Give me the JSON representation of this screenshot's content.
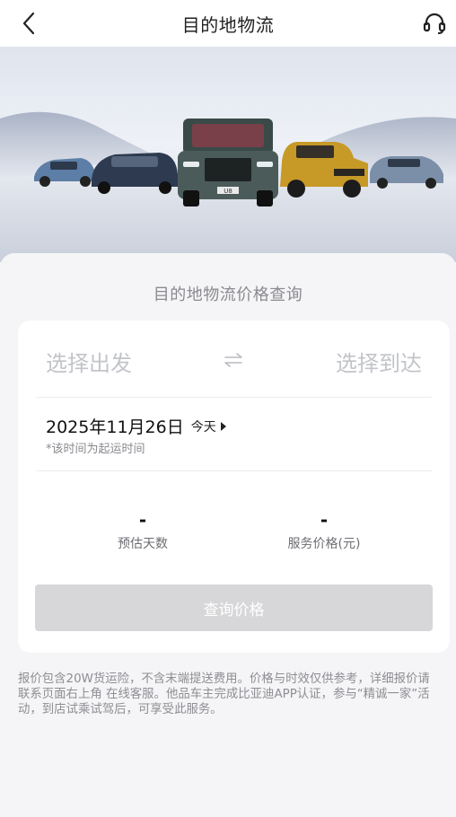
{
  "header": {
    "title": "目的地物流",
    "back_icon": "chevron-left-icon",
    "support_icon": "headset-icon"
  },
  "banner": {
    "image": "car-lineup-banner",
    "plate_text": "U8"
  },
  "page": {
    "section_title": "目的地物流价格查询"
  },
  "route": {
    "from_placeholder": "选择出发",
    "to_placeholder": "选择到达",
    "swap_icon": "swap-arrows-icon"
  },
  "date": {
    "value": "2025年11月26日",
    "today_label": "今天",
    "note": "*该时间为起运时间"
  },
  "stats": {
    "days_value": "-",
    "days_label": "预估天数",
    "price_value": "-",
    "price_label": "服务价格(元)"
  },
  "actions": {
    "query_label": "查询价格"
  },
  "footnote": "报价包含20W货运险，不含末端提送费用。价格与时效仅供参考，详细报价请联系页面右上角 在线客服。他品车主完成比亚迪APP认证，参与“精诚一家”活动，到店试乘试驾后，可享受此服务。",
  "colors": {
    "placeholder": "#c2c4c9",
    "button_disabled": "#d7d7d9",
    "background": "#f5f5f7"
  }
}
